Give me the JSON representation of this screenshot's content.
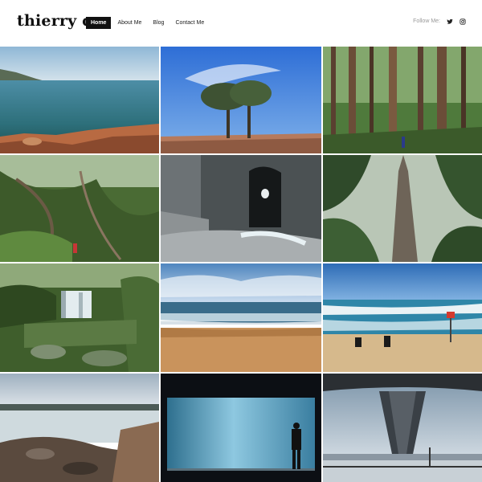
{
  "site": {
    "logo": "thierry c."
  },
  "nav": {
    "items": [
      {
        "label": "Home",
        "active": true
      },
      {
        "label": "About Me",
        "active": false
      },
      {
        "label": "Blog",
        "active": false
      },
      {
        "label": "Contact Me",
        "active": false
      }
    ]
  },
  "social": {
    "label": "Follow Me:",
    "icons": [
      "twitter-icon",
      "instagram-icon"
    ]
  },
  "gallery": {
    "photos": [
      {
        "name": "coastal-bay-photo"
      },
      {
        "name": "lone-tree-photo"
      },
      {
        "name": "tall-forest-photo"
      },
      {
        "name": "rainforest-hiker-photo"
      },
      {
        "name": "sea-cave-arch-photo"
      },
      {
        "name": "giant-tree-trunk-photo"
      },
      {
        "name": "waterfall-photo"
      },
      {
        "name": "beach-shore-photo"
      },
      {
        "name": "surfers-beach-photo"
      },
      {
        "name": "rocky-shoreline-photo"
      },
      {
        "name": "aquarium-silhouette-photo"
      },
      {
        "name": "harbour-bridge-photo"
      }
    ]
  }
}
